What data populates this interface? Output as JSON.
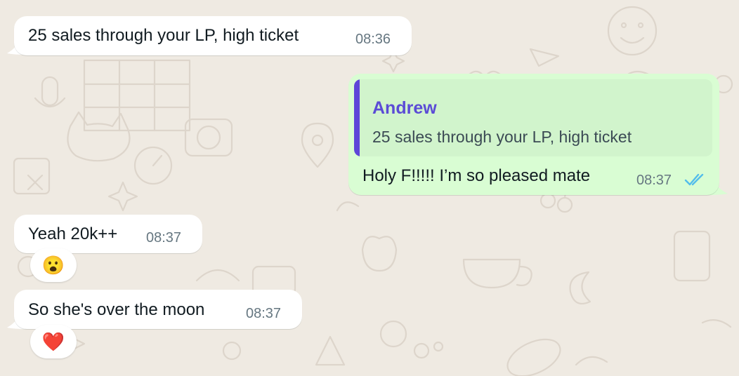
{
  "messages": [
    {
      "direction": "incoming",
      "text": "25 sales through your LP, high ticket",
      "time": "08:36"
    },
    {
      "direction": "outgoing",
      "quote": {
        "author": "Andrew",
        "text": "25 sales through your LP, high ticket"
      },
      "text": "Holy F!!!!! I’m so pleased mate",
      "time": "08:37",
      "status": "read",
      "status_icon": "double-check-icon"
    },
    {
      "direction": "incoming",
      "text": "Yeah 20k++",
      "time": "08:37",
      "reaction": "😮"
    },
    {
      "direction": "incoming",
      "text": "So she's over the moon",
      "time": "08:37",
      "reaction": "❤️"
    }
  ],
  "colors": {
    "wallpaper": "#efeae2",
    "incoming_bubble": "#ffffff",
    "outgoing_bubble": "#d9fdd3",
    "quote_accent": "#5e46d8",
    "read_ticks": "#53bdeb",
    "timestamp": "#667781"
  }
}
